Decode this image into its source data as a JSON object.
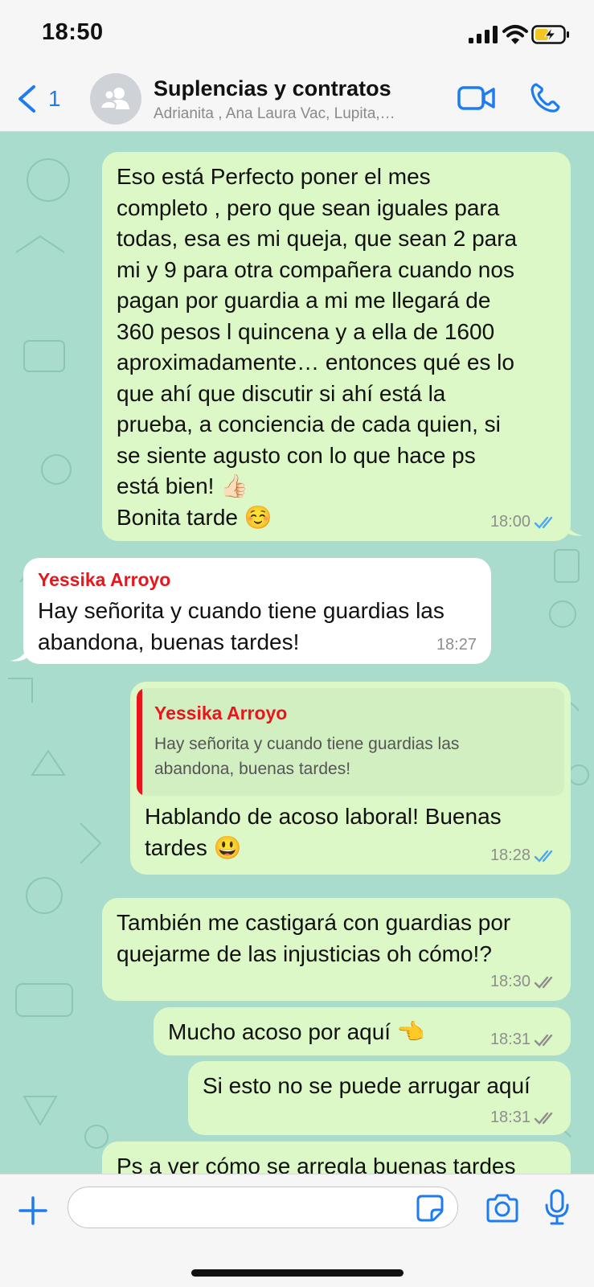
{
  "status": {
    "time": "18:50"
  },
  "header": {
    "back_count": "1",
    "title": "Suplencias y contratos",
    "subtitle": "Adrianita , Ana Laura Vac, Lupita,…"
  },
  "messages": [
    {
      "type": "outgoing",
      "text": "Eso está  Perfecto poner el mes\ncompleto , pero que sean iguales para\ntodas, esa es mi queja, que sean 2 para\nmi y 9 para otra compañera cuando nos\npagan por guardia a mi me llegará de\n360 pesos l quincena y a ella de 1600\naproximadamente… entonces qué es lo\nque ahí que discutir si ahí está la\nprueba, a conciencia de cada quien, si\nse siente agusto con lo que hace ps\nestá bien! 👍🏻\nBonita tarde ☺️",
      "time": "18:00",
      "status": "read"
    },
    {
      "type": "incoming",
      "sender": "Yessika Arroyo",
      "text": "Hay señorita y cuando tiene guardias las\nabandona, buenas tardes!",
      "time": "18:27"
    },
    {
      "type": "outgoing",
      "quote": {
        "sender": "Yessika Arroyo",
        "text": "Hay señorita y cuando tiene guardias las\nabandona, buenas tardes!"
      },
      "text": "Hablando de acoso laboral! Buenas\ntardes 😃",
      "time": "18:28",
      "status": "read"
    },
    {
      "type": "outgoing",
      "text": "También me castigará con guardias por\nquejarme de las injusticias oh cómo!?",
      "time": "18:30",
      "status": "delivered"
    },
    {
      "type": "outgoing",
      "text": "Mucho acoso por aquí 👈",
      "time": "18:31",
      "status": "delivered"
    },
    {
      "type": "outgoing",
      "text": "Si esto no se puede arrugar aquí",
      "time": "18:31",
      "status": "delivered"
    },
    {
      "type": "outgoing",
      "text": "Ps a ver cómo se arregla buenas tardes",
      "time": "",
      "status": ""
    }
  ],
  "input": {
    "placeholder": ""
  },
  "colors": {
    "accent": "#1e7cf2",
    "chat_background": "#a9dccd",
    "outgoing_bubble": "#dcf8c6",
    "incoming_bubble": "#ffffff",
    "sender_name": "#e8161c",
    "read_ticks": "#4fa6f0",
    "delivered_ticks": "#8e8e8e"
  },
  "icons": [
    "signal-icon",
    "wifi-icon",
    "battery-charging-icon",
    "back-chevron-icon",
    "group-avatar-icon",
    "video-call-icon",
    "phone-call-icon",
    "read-ticks-icon",
    "delivered-ticks-icon",
    "plus-icon",
    "sticker-icon",
    "camera-icon",
    "microphone-icon"
  ]
}
